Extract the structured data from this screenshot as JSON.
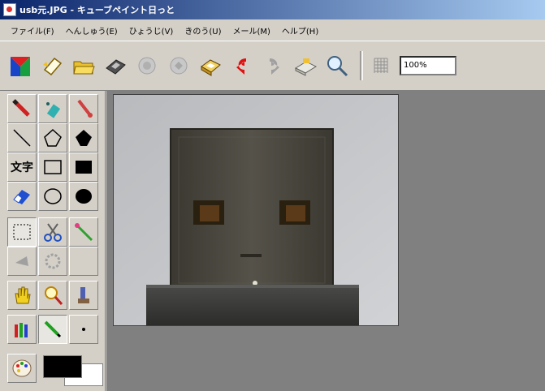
{
  "window": {
    "title": "usb元.JPG - キューブペイント日っと"
  },
  "menu": {
    "items": [
      {
        "label": "ファイル(F)"
      },
      {
        "label": "へんしゅう(E)"
      },
      {
        "label": "ひょうじ(V)"
      },
      {
        "label": "きのう(U)"
      },
      {
        "label": "メール(M)"
      },
      {
        "label": "ヘルプ(H)"
      }
    ]
  },
  "toolbar": {
    "zoom": "100%",
    "buttons": [
      {
        "name": "logo-icon"
      },
      {
        "name": "new-icon"
      },
      {
        "name": "open-icon"
      },
      {
        "name": "save-icon"
      },
      {
        "name": "stamp-icon"
      },
      {
        "name": "stamp2-icon"
      },
      {
        "name": "print-icon"
      },
      {
        "name": "undo-icon"
      },
      {
        "name": "redo-icon"
      },
      {
        "name": "scan-icon"
      },
      {
        "name": "zoom-tool-icon"
      },
      {
        "name": "grid-icon"
      }
    ]
  },
  "tools": {
    "text_tool_label": "文字"
  },
  "colors": {
    "foreground": "#000000",
    "background": "#ffffff",
    "workspace": "#808080",
    "accent": "#0a246a"
  }
}
